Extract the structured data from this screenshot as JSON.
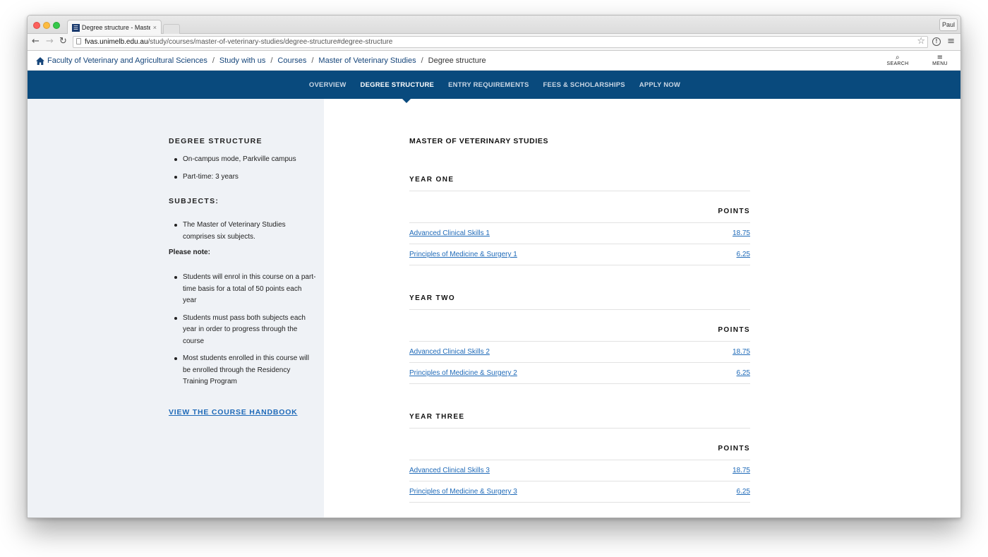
{
  "browser": {
    "tab_title": "Degree structure - Master",
    "tab_close": "×",
    "profile_name": "Paul",
    "url_host": "fvas.unimelb.edu.au",
    "url_path": "/study/courses/master-of-veterinary-studies/degree-structure#degree-structure",
    "favicon_glyph": "☰"
  },
  "breadcrumb": {
    "items": [
      "Faculty of Veterinary and Agricultural Sciences",
      "Study with us",
      "Courses",
      "Master of Veterinary Studies"
    ],
    "current": "Degree structure",
    "separator": "/"
  },
  "utility": {
    "search_label": "SEARCH",
    "menu_label": "MENU"
  },
  "subnav": {
    "items": [
      "OVERVIEW",
      "DEGREE STRUCTURE",
      "ENTRY REQUIREMENTS",
      "FEES & SCHOLARSHIPS",
      "APPLY NOW"
    ],
    "active": "DEGREE STRUCTURE"
  },
  "sidebar": {
    "degree_heading": "DEGREE STRUCTURE",
    "degree_items": [
      "On-campus mode, Parkville campus",
      "Part-time: 3 years"
    ],
    "subjects_heading": "SUBJECTS:",
    "subjects_items": [
      "The Master of Veterinary Studies comprises six subjects."
    ],
    "note_label": "Please note:",
    "note_items": [
      "Students will enrol in this course on a part-time basis for a total of 50 points each year",
      "Students must pass both subjects each year in order to progress through the course",
      "Most students enrolled in this course will be enrolled through the Residency Training Program"
    ],
    "handbook_link": "VIEW THE COURSE HANDBOOK"
  },
  "main": {
    "title": "MASTER OF VETERINARY STUDIES",
    "points_header": "POINTS",
    "years": [
      {
        "title": "YEAR ONE",
        "subjects": [
          {
            "name": "Advanced Clinical Skills 1",
            "points": "18.75"
          },
          {
            "name": "Principles of Medicine & Surgery 1",
            "points": "6.25"
          }
        ]
      },
      {
        "title": "YEAR TWO",
        "subjects": [
          {
            "name": "Advanced Clinical Skills 2",
            "points": "18.75"
          },
          {
            "name": "Principles of Medicine & Surgery 2",
            "points": "6.25"
          }
        ]
      },
      {
        "title": "YEAR THREE",
        "subjects": [
          {
            "name": "Advanced Clinical Skills 3",
            "points": "18.75"
          },
          {
            "name": "Principles of Medicine & Surgery 3",
            "points": "6.25"
          }
        ]
      }
    ]
  },
  "colors": {
    "brand_navy": "#094a7d",
    "link_blue": "#1f6ab8",
    "sidebar_bg": "#eff2f6"
  }
}
